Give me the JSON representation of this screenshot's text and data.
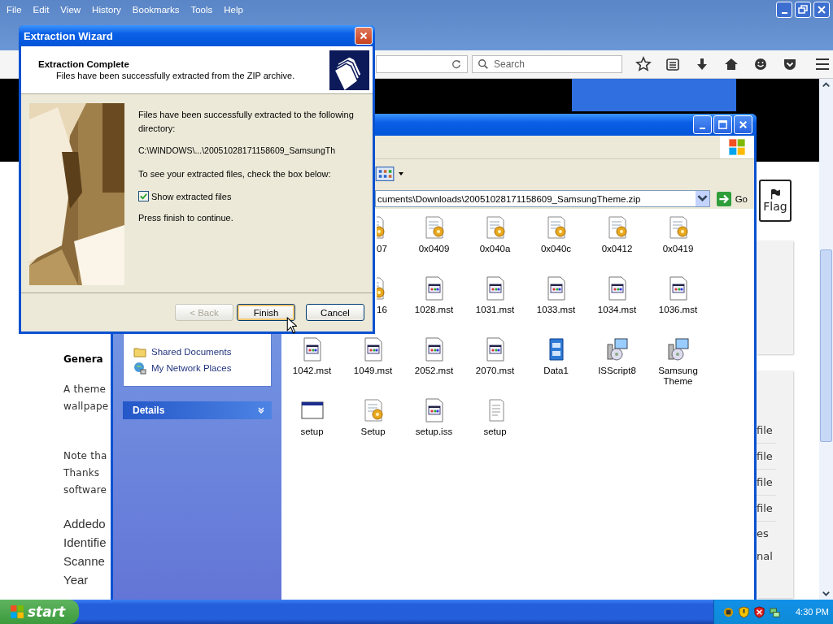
{
  "browser": {
    "menu": [
      "File",
      "Edit",
      "View",
      "History",
      "Bookmarks",
      "Tools",
      "Help"
    ],
    "search": {
      "placeholder": "Search"
    }
  },
  "page": {
    "paragraphs": [
      {
        "kind": "heading",
        "lines": [
          "Genera"
        ]
      },
      {
        "kind": "body",
        "lines": [
          "A theme",
          "wallpape"
        ]
      },
      {
        "kind": "body",
        "lines": [
          "Note tha",
          "Thanks",
          "software"
        ]
      },
      {
        "kind": "large",
        "lines": [
          "Addedo",
          "Identifie",
          "Scanne",
          "Year"
        ]
      }
    ],
    "flag_button": "Flag",
    "side_rows": [
      {
        "text": "file",
        "kind": "row"
      },
      {
        "text": "file",
        "kind": "row"
      },
      {
        "text": "file",
        "kind": "row"
      },
      {
        "text": "file",
        "kind": "row"
      },
      {
        "text": "es",
        "kind": "plain"
      },
      {
        "text": "nal",
        "kind": "plain"
      }
    ]
  },
  "explorer": {
    "address": "cuments\\Downloads\\20051028171158609_SamsungTheme.zip",
    "go": "Go",
    "tasks": [
      {
        "label": "Shared Documents",
        "kind": "folder"
      },
      {
        "label": "My Network Places",
        "kind": "network"
      }
    ],
    "details": "Details",
    "files": [
      {
        "name": "07",
        "kind": "config",
        "partial": true
      },
      {
        "name": "0x0409",
        "kind": "config",
        "partial": false
      },
      {
        "name": "0x040a",
        "kind": "config",
        "partial": false
      },
      {
        "name": "0x040c",
        "kind": "config",
        "partial": false
      },
      {
        "name": "0x0412",
        "kind": "config",
        "partial": false
      },
      {
        "name": "0x0419",
        "kind": "config",
        "partial": false
      },
      {
        "name": "16",
        "kind": "config",
        "partial": true
      },
      {
        "name": "1028.mst",
        "kind": "mst",
        "partial": false
      },
      {
        "name": "1031.mst",
        "kind": "mst",
        "partial": false
      },
      {
        "name": "1033.mst",
        "kind": "mst",
        "partial": false
      },
      {
        "name": "1034.mst",
        "kind": "mst",
        "partial": false
      },
      {
        "name": "1036.mst",
        "kind": "mst",
        "partial": false
      },
      {
        "name": "1042.mst",
        "kind": "mst",
        "partial": false
      },
      {
        "name": "1049.mst",
        "kind": "mst",
        "partial": false
      },
      {
        "name": "2052.mst",
        "kind": "mst",
        "partial": false
      },
      {
        "name": "2070.mst",
        "kind": "mst",
        "partial": false
      },
      {
        "name": "Data1",
        "kind": "cabinet",
        "partial": false
      },
      {
        "name": "ISScript8",
        "kind": "installer",
        "partial": false
      },
      {
        "name": "Samsung Theme",
        "kind": "installer",
        "partial": false
      },
      {
        "name": "setup",
        "kind": "window",
        "partial": false
      },
      {
        "name": "Setup",
        "kind": "config",
        "partial": false
      },
      {
        "name": "setup.iss",
        "kind": "mst",
        "partial": false
      },
      {
        "name": "setup",
        "kind": "text",
        "partial": false
      }
    ]
  },
  "wizard": {
    "title": "Extraction Wizard",
    "heading": "Extraction Complete",
    "subheading": "Files have been successfully extracted from the ZIP archive.",
    "intro": "Files have been successfully extracted to the following directory:",
    "path": "C:\\WINDOWS\\...\\20051028171158609_SamsungTh",
    "instruction": "To see your extracted files, check the box below:",
    "checkbox": {
      "label": "Show extracted files",
      "checked": true
    },
    "note": "Press finish to continue.",
    "buttons": [
      {
        "label": "< Back",
        "disabled": true,
        "default": false
      },
      {
        "label": "Finish",
        "disabled": false,
        "default": true
      },
      {
        "label": "Cancel",
        "disabled": false,
        "default": false
      }
    ]
  },
  "taskbar": {
    "start": "start",
    "clock": "4:30 PM"
  }
}
